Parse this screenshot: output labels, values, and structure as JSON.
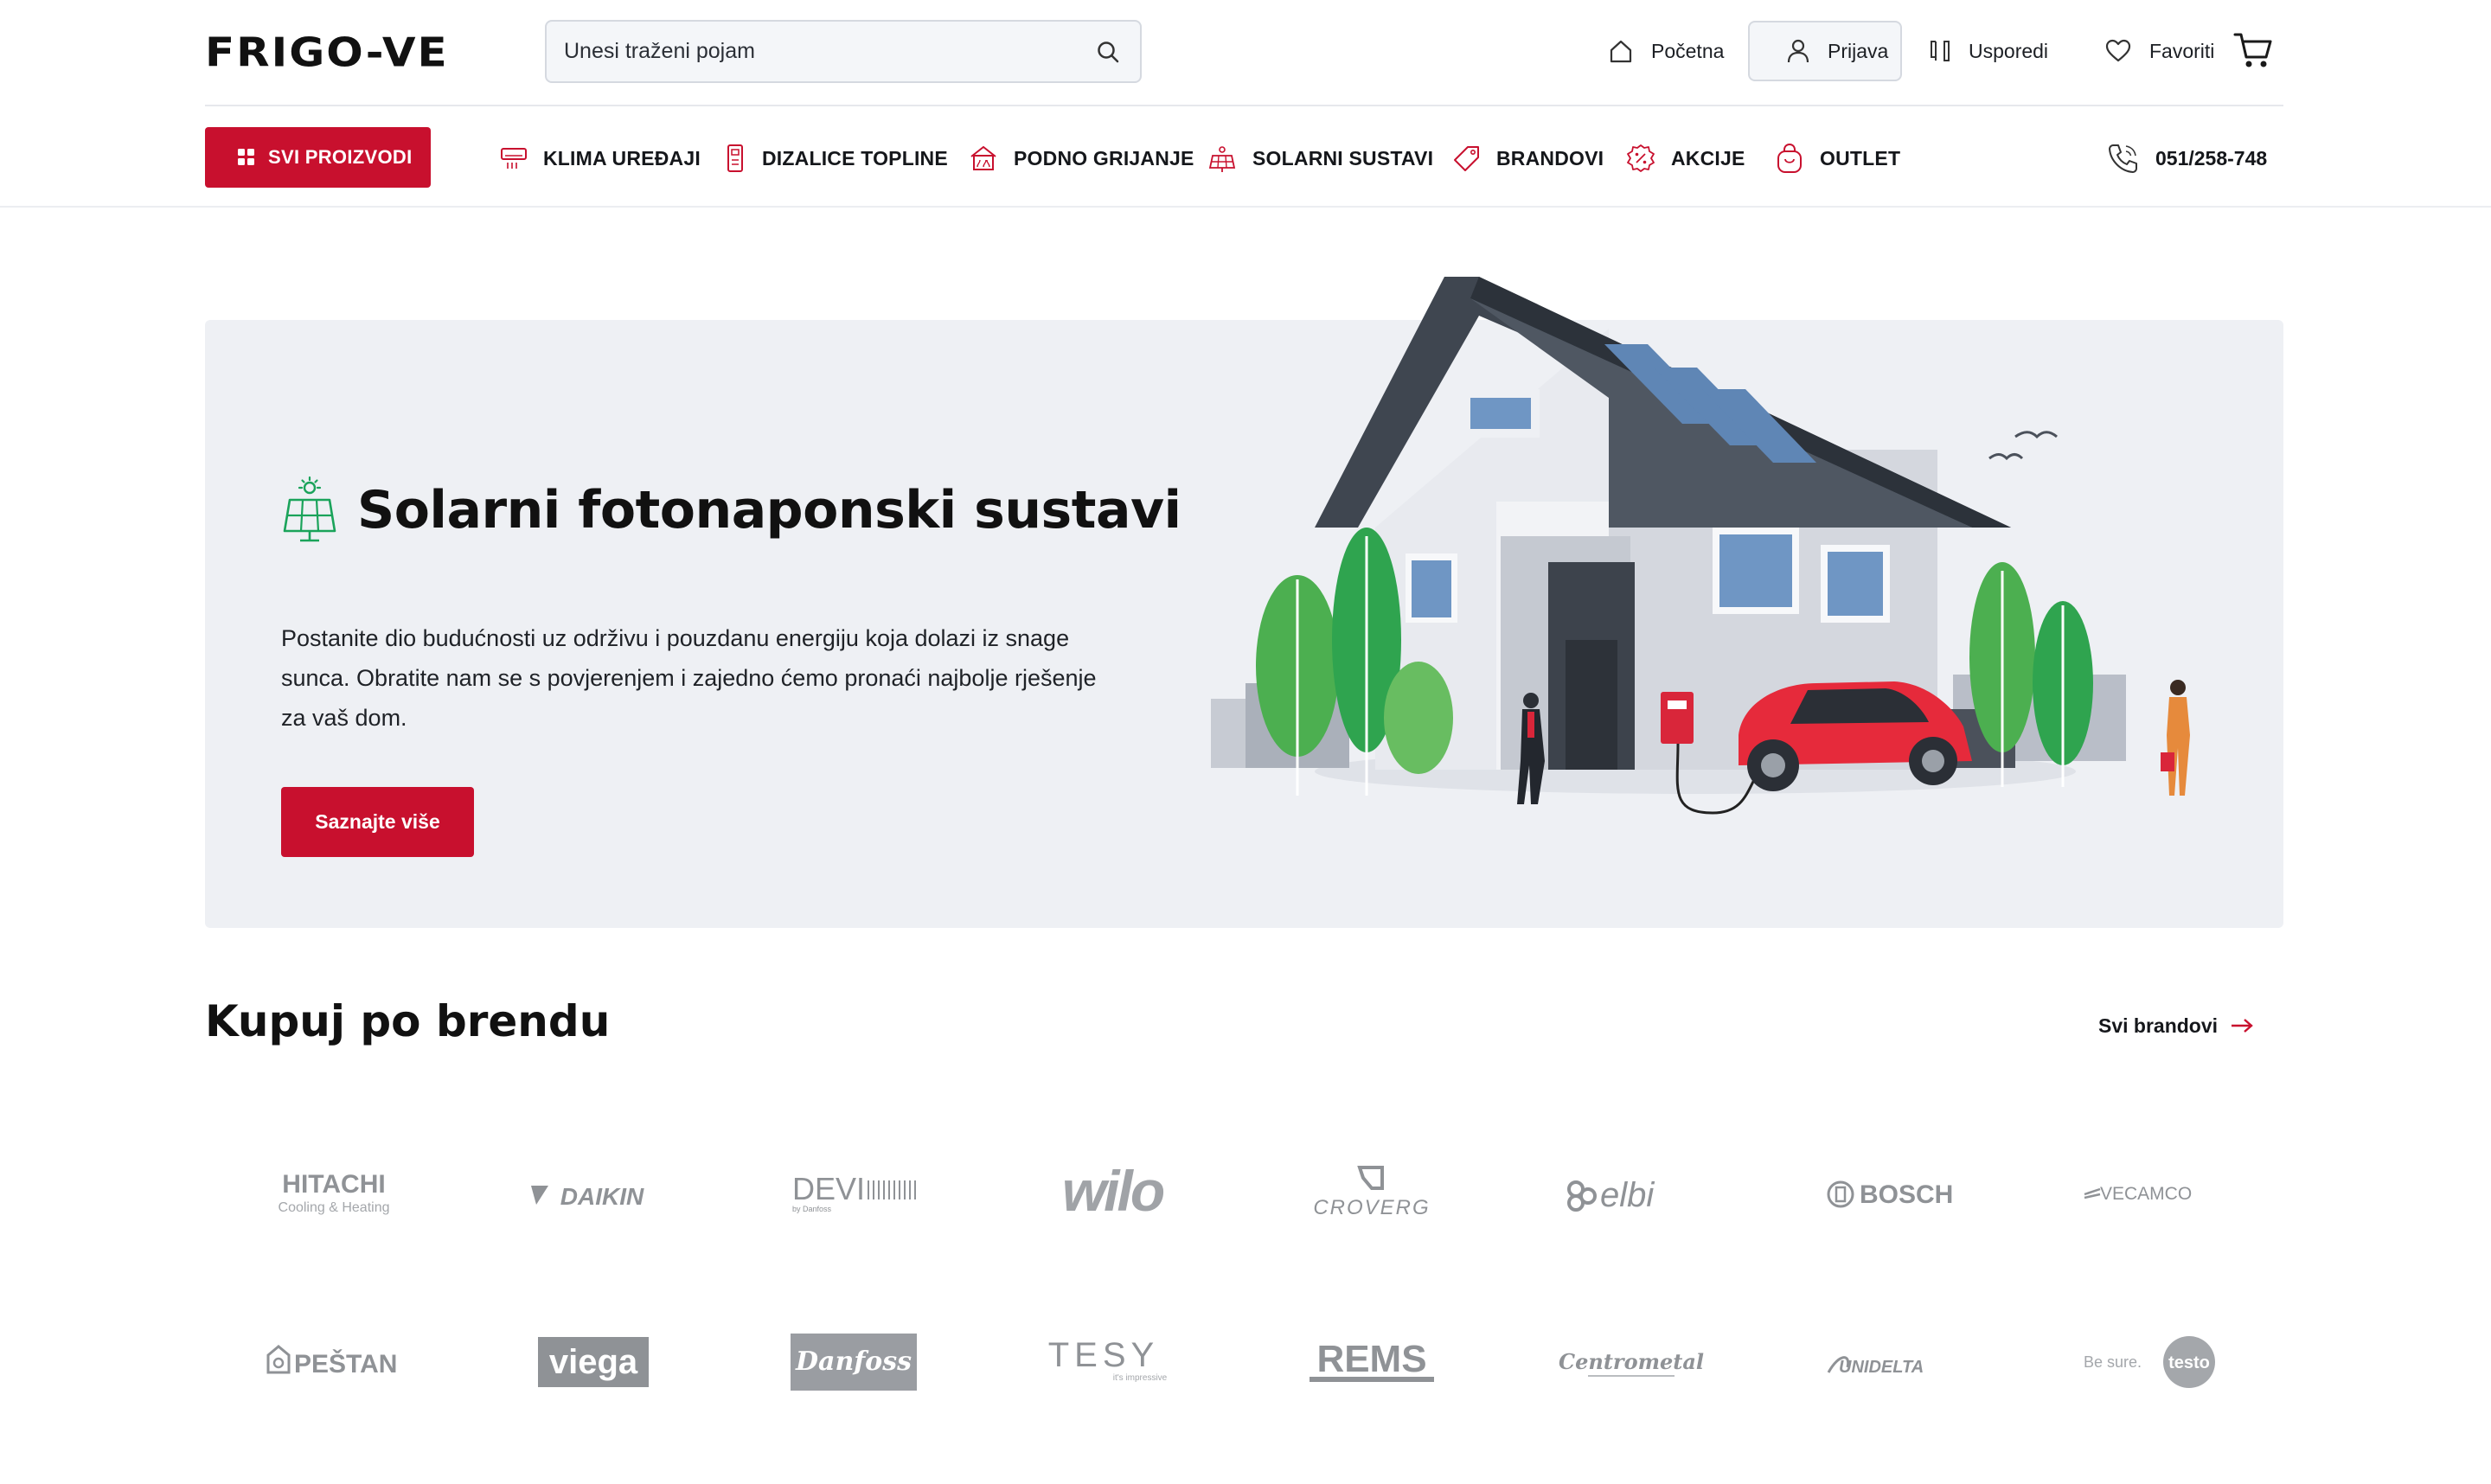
{
  "header": {
    "logo": "FRIGO-VE",
    "search_placeholder": "Unesi traženi pojam",
    "nav": {
      "home": "Početna",
      "login": "Prijava",
      "compare": "Usporedi",
      "favorites": "Favoriti"
    }
  },
  "categories": {
    "all_products": "SVI PROIZVODI",
    "items": [
      "KLIMA UREĐAJI",
      "DIZALICE TOPLINE",
      "PODNO GRIJANJE",
      "SOLARNI SUSTAVI",
      "BRANDOVI",
      "AKCIJE",
      "OUTLET"
    ],
    "phone": "051/258-748"
  },
  "hero": {
    "title": "Solarni fotonaponski sustavi",
    "text": "Postanite dio budućnosti uz održivu i pouzdanu energiju koja dolazi iz snage sunca. Obratite nam se s povjerenjem i zajedno ćemo pronaći najbolje rješenje za vaš dom.",
    "button": "Saznajte više"
  },
  "brands": {
    "title": "Kupuj po brendu",
    "all_link": "Svi brandovi",
    "logos": [
      "HITACHI",
      "Cooling & Heating",
      "DAIKIN",
      "DEVI",
      "by Danfoss",
      "wilo",
      "CROVERG",
      "elbi",
      "BOSCH",
      "VECAMCO",
      "PEŠTAN",
      "viega",
      "Danfoss",
      "TESY",
      "it's impressive",
      "REMS",
      "Centrometal",
      "UNIDELTA",
      "Be sure.",
      "testo"
    ]
  },
  "colors": {
    "brand_red": "#c8102e",
    "hero_bg": "#eef0f4",
    "solar_green": "#1aa35a",
    "logo_gray": "#8f9296"
  }
}
